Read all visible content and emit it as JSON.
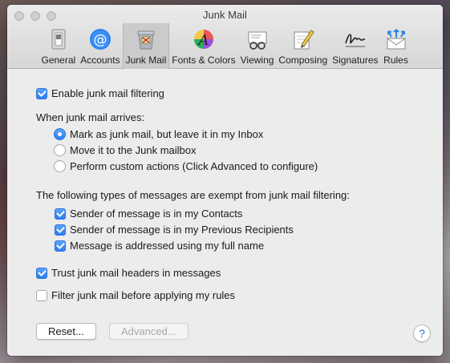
{
  "window": {
    "title": "Junk Mail"
  },
  "toolbar": {
    "tabs": [
      {
        "label": "General",
        "icon": "general-switch-icon"
      },
      {
        "label": "Accounts",
        "icon": "at-sign-icon"
      },
      {
        "label": "Junk Mail",
        "icon": "junk-trash-icon",
        "selected": true
      },
      {
        "label": "Fonts & Colors",
        "icon": "font-palette-icon"
      },
      {
        "label": "Viewing",
        "icon": "glasses-envelope-icon"
      },
      {
        "label": "Composing",
        "icon": "pencil-pad-icon"
      },
      {
        "label": "Signatures",
        "icon": "signature-icon"
      },
      {
        "label": "Rules",
        "icon": "rules-envelope-icon"
      }
    ]
  },
  "junk": {
    "enable_label": "Enable junk mail filtering",
    "enable_checked": true,
    "arrives_heading": "When junk mail arrives:",
    "actions": [
      {
        "label": "Mark as junk mail, but leave it in my Inbox",
        "selected": true
      },
      {
        "label": "Move it to the Junk mailbox",
        "selected": false
      },
      {
        "label": "Perform custom actions (Click Advanced to configure)",
        "selected": false
      }
    ],
    "exempt_heading": "The following types of messages are exempt from junk mail filtering:",
    "exemptions": [
      {
        "label": "Sender of message is in my Contacts",
        "checked": true
      },
      {
        "label": "Sender of message is in my Previous Recipients",
        "checked": true
      },
      {
        "label": "Message is addressed using my full name",
        "checked": true
      }
    ],
    "trust_label": "Trust junk mail headers in messages",
    "trust_checked": true,
    "filter_label": "Filter junk mail before applying my rules",
    "filter_checked": false
  },
  "buttons": {
    "reset": "Reset...",
    "advanced": "Advanced...",
    "help": "?"
  },
  "colors": {
    "accent": "#2a7ef0",
    "window_bg": "#ececec",
    "toolbar_selected": "#cbcbcb"
  }
}
